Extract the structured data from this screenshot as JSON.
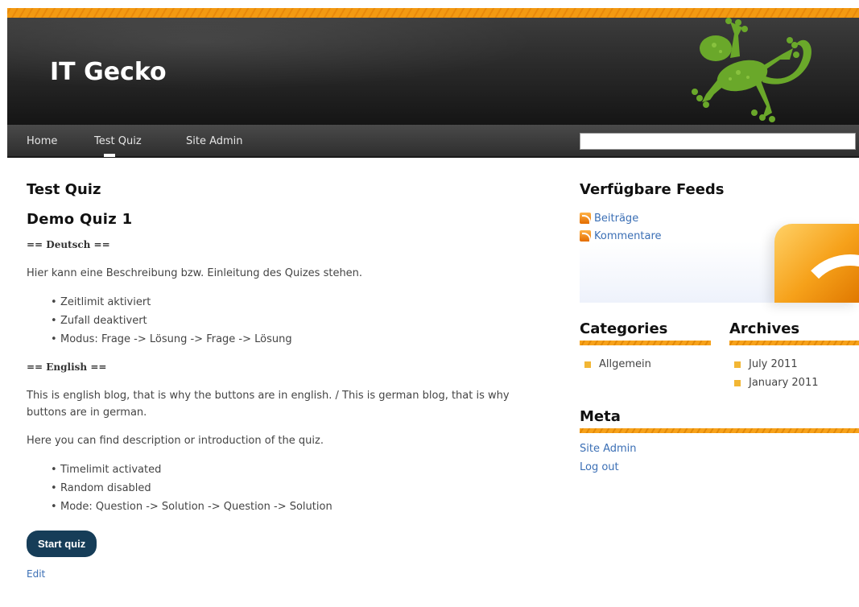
{
  "site": {
    "title": "IT Gecko"
  },
  "nav": {
    "items": [
      {
        "label": "Home"
      },
      {
        "label": "Test Quiz"
      },
      {
        "label": "Site Admin"
      }
    ],
    "search_value": ""
  },
  "post": {
    "title": "Test Quiz",
    "quiz_title": "Demo Quiz 1",
    "de_heading": "== Deutsch ==",
    "de_intro": "Hier kann eine Beschreibung bzw. Einleitung des Quizes stehen.",
    "de_list": [
      "Zeitlimit aktiviert",
      "Zufall deaktivert",
      "Modus: Frage -> Lösung -> Frage -> Lösung"
    ],
    "en_heading": "== English ==",
    "en_blog": "This is english blog, that is why the buttons are in english. / This is german blog, that is why buttons are in german.",
    "en_intro": "Here you can find description or introduction of the quiz.",
    "en_list": [
      "Timelimit activated",
      "Random disabled",
      "Mode: Question -> Solution -> Question -> Solution"
    ],
    "start_button": "Start quiz",
    "edit_link": "Edit"
  },
  "sidebar": {
    "feeds_title": "Verfügbare Feeds",
    "feeds": [
      "Beiträge",
      "Kommentare"
    ],
    "categories_title": "Categories",
    "categories": [
      "Allgemein"
    ],
    "archives_title": "Archives",
    "archives": [
      "July 2011",
      "January 2011"
    ],
    "meta_title": "Meta",
    "meta": [
      "Site Admin",
      "Log out"
    ]
  },
  "colors": {
    "accent_orange": "#f39a12",
    "header_dark": "#2a2a2a",
    "link_blue": "#3b6fb5",
    "button_navy": "#163d58",
    "gecko_green": "#6aa82a"
  }
}
